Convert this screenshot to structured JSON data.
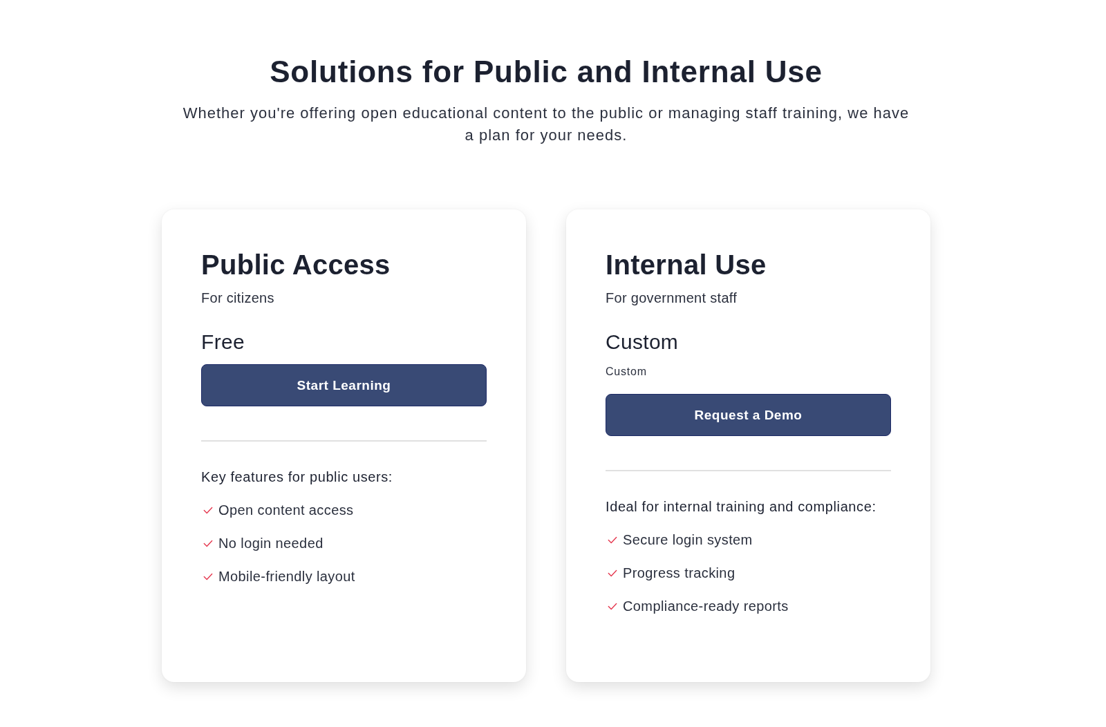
{
  "header": {
    "title": "Solutions for Public and Internal Use",
    "subtitle": "Whether you're offering open educational content to the public or managing staff training, we have a plan for your needs."
  },
  "plans": [
    {
      "name": "Public Access",
      "audience": "For citizens",
      "price": "Free",
      "button": "Start Learning",
      "features_heading": "Key features for public users:",
      "features": [
        "Open content access",
        "No login needed",
        "Mobile-friendly layout"
      ]
    },
    {
      "name": "Internal Use",
      "audience": "For government staff",
      "price": "Custom",
      "price_note": "Custom",
      "button": "Request a Demo",
      "features_heading": "Ideal for internal training and compliance:",
      "features": [
        "Secure login system",
        "Progress tracking",
        "Compliance-ready reports"
      ]
    }
  ]
}
